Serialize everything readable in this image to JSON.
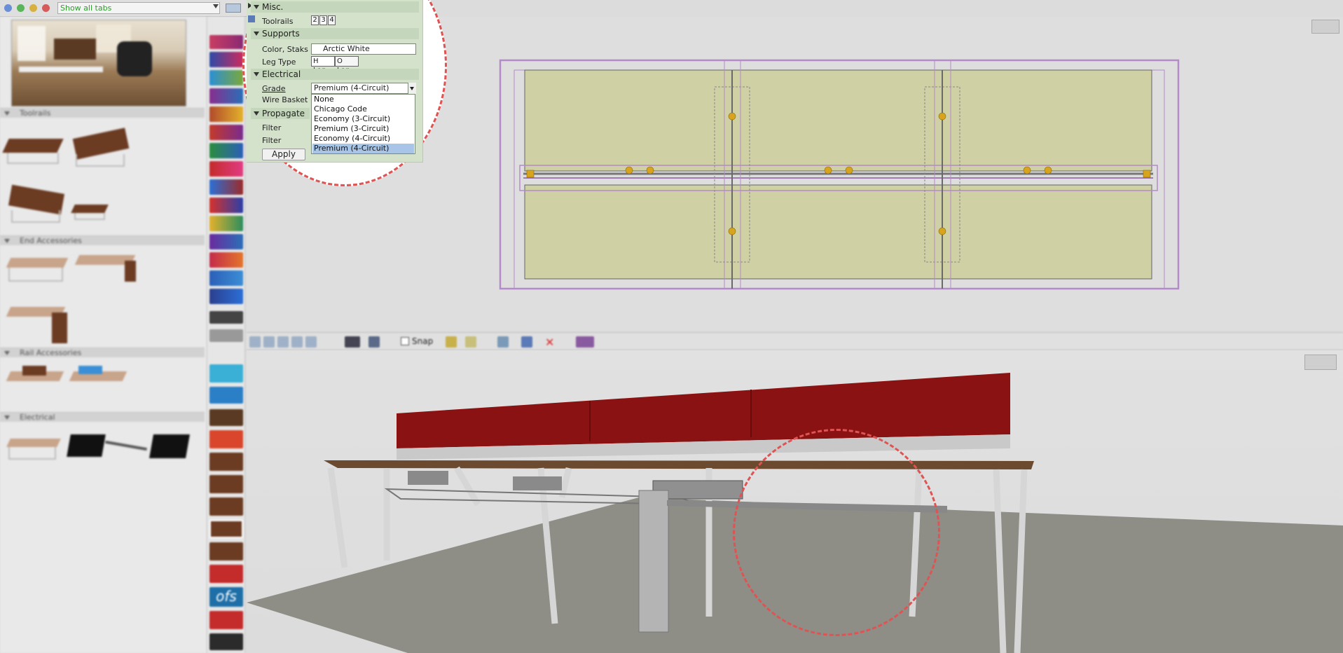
{
  "toolbar": {
    "show_all_tabs": "Show all tabs"
  },
  "catalog": {
    "sections": [
      {
        "label": "Toolrails"
      },
      {
        "label": "End Accessories"
      },
      {
        "label": "Rail Accessories"
      },
      {
        "label": "Electrical"
      }
    ]
  },
  "props": {
    "misc": {
      "header": "Misc.",
      "toolrails_label": "Toolrails",
      "toolrail_options": [
        "2",
        "3",
        "4"
      ]
    },
    "supports": {
      "header": "Supports",
      "color_label": "Color, Staks",
      "color_value": "Arctic White",
      "leg_type_label": "Leg Type",
      "leg_options": [
        "H Leg",
        "O Leg"
      ]
    },
    "electrical": {
      "header": "Electrical",
      "grade_label": "Grade",
      "grade_value": "Premium (4-Circuit)",
      "wire_basket_label": "Wire Basket",
      "grade_options": [
        "None",
        "Chicago Code",
        "Economy (3-Circuit)",
        "Premium (3-Circuit)",
        "Economy (4-Circuit)",
        "Premium (4-Circuit)"
      ]
    },
    "propagate": {
      "header": "Propagate",
      "filter1": "Filter",
      "filter2": "Filter"
    },
    "apply_label": "Apply"
  },
  "mid_toolbar": {
    "snap_label": "Snap"
  },
  "brands": {
    "ofs": "ofs"
  },
  "colors": {
    "panel_green": "#d4e2cc",
    "screen_red": "#8a1212",
    "dash_red": "#e05353"
  }
}
